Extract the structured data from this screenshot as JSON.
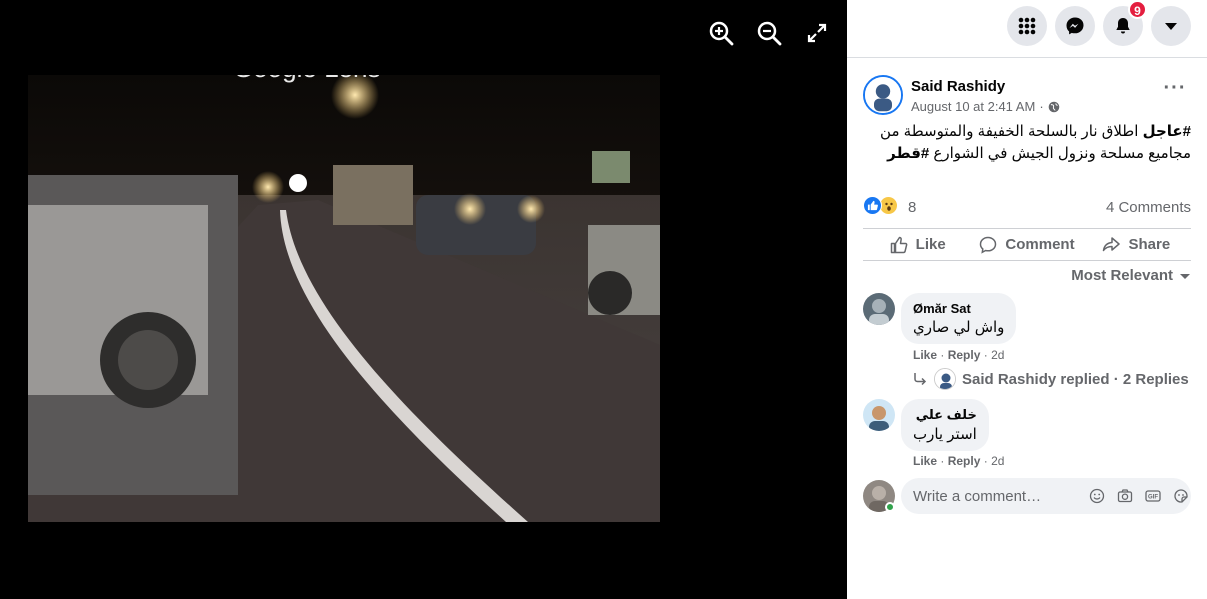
{
  "notifications": {
    "badge_count": "9"
  },
  "post": {
    "author": "Said Rashidy",
    "timestamp": "August 10 at 2:41 AM",
    "separator": "·",
    "hashtag_urgent": "#عاجل",
    "text_line1": " اطلاق نار بالسلحة الخفيفة والمتوسطة من",
    "text_line2": "مجاميع مسلحة ونزول الجيش في الشوارع ",
    "hashtag_qatar": "#قطر",
    "reaction_count": "8",
    "comment_count": "4 Comments",
    "image_watermark": "Google Lens"
  },
  "actions": {
    "like": "Like",
    "comment": "Comment",
    "share": "Share"
  },
  "sort_label": "Most Relevant",
  "comments": [
    {
      "name": "Ømăr Sat",
      "text": "واش لي صاري",
      "like": "Like",
      "reply": "Reply",
      "age": "2d",
      "dot": "·"
    },
    {
      "name": "خلف علي",
      "text": "استر يارب",
      "like": "Like",
      "reply": "Reply",
      "age": "2d",
      "dot": "·"
    }
  ],
  "reply_summary": "Said Rashidy replied · 2 Replies",
  "write_placeholder": "Write a comment…",
  "colors": {
    "brand": "#1877f2",
    "badge": "#e41e3f",
    "online": "#31a24c"
  },
  "icons": [
    "zoom-in-icon",
    "zoom-out-icon",
    "fullscreen-icon",
    "menu-grid-icon",
    "messenger-icon",
    "bell-icon",
    "caret-down-icon",
    "globe-icon",
    "more-icon",
    "like-reaction-icon",
    "wow-reaction-icon",
    "thumbs-up-icon",
    "comment-icon",
    "share-icon",
    "reply-arrow-icon",
    "emoji-icon",
    "camera-icon",
    "gif-icon",
    "sticker-icon"
  ]
}
